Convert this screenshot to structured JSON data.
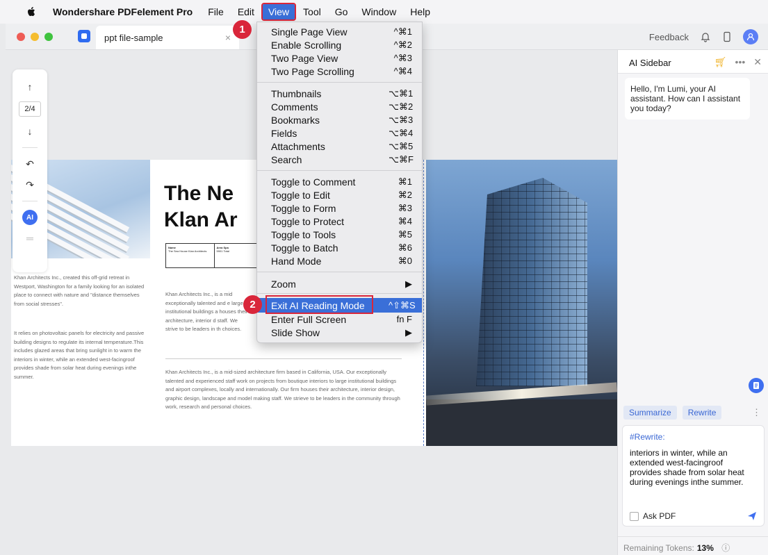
{
  "menubar": {
    "app": "Wondershare PDFelement Pro",
    "items": [
      "File",
      "Edit",
      "View",
      "Tool",
      "Go",
      "Window",
      "Help"
    ]
  },
  "tab": {
    "title": "ppt file-sample",
    "close": "×"
  },
  "toolbar_right": {
    "feedback": "Feedback"
  },
  "left_tools": {
    "page": "2/4",
    "ai": "AI"
  },
  "document": {
    "headline_1": "The Ne",
    "headline_2": "Klan Ar",
    "table_col1": "Name",
    "table_col2": "Area Spa",
    "table_val1": "The Sea House Klan Architects",
    "table_val2": "5901 Total",
    "left_para1": "Khan Architects Inc., created this off-grid retreat in Westport, Washington for a family looking for an isolated place to connect with nature and \"distance themselves from social stresses\".",
    "left_para2": "It relies on photovoltaic panels for electricity and passive building designs to regulate its internal temperature.This includes glazed areas that bring sunlight in to warm the interiors in winter, while an extended west-facingroof provides shade from solar heat during evenings inthe summer.",
    "mid_para1": "Khan Architects Inc., is a mid exceptionally talented and e large institutional buildings a houses their architecture, interior d staff. We strive to be leaders in th choices.",
    "mid_para2": "Khan Architects Inc., is a mid-sized architecture firm based in California, USA. Our exceptionally talented and experienced staff work on projects from boutique interiors to large institutional buildings and airport complexes, locally and internationally. Our firm houses their architecture, interior design, graphic design, landscape and model making staff. We strieve to be leaders in the community through work, research and personal choices."
  },
  "view_menu": {
    "items": [
      {
        "label": "Single Page View",
        "shortcut": "^⌘1"
      },
      {
        "label": "Enable Scrolling",
        "shortcut": "^⌘2"
      },
      {
        "label": "Two Page View",
        "shortcut": "^⌘3"
      },
      {
        "label": "Two Page Scrolling",
        "shortcut": "^⌘4"
      },
      {
        "label": "Thumbnails",
        "shortcut": "⌥⌘1"
      },
      {
        "label": "Comments",
        "shortcut": "⌥⌘2"
      },
      {
        "label": "Bookmarks",
        "shortcut": "⌥⌘3"
      },
      {
        "label": "Fields",
        "shortcut": "⌥⌘4"
      },
      {
        "label": "Attachments",
        "shortcut": "⌥⌘5"
      },
      {
        "label": "Search",
        "shortcut": "⌥⌘F"
      },
      {
        "label": "Toggle to Comment",
        "shortcut": "⌘1"
      },
      {
        "label": "Toggle to Edit",
        "shortcut": "⌘2"
      },
      {
        "label": "Toggle to Form",
        "shortcut": "⌘3"
      },
      {
        "label": "Toggle to Protect",
        "shortcut": "⌘4"
      },
      {
        "label": "Toggle to Tools",
        "shortcut": "⌘5"
      },
      {
        "label": "Toggle to Batch",
        "shortcut": "⌘6"
      },
      {
        "label": "Hand Mode",
        "shortcut": "⌘0"
      },
      {
        "label": "Zoom",
        "shortcut": "▶"
      },
      {
        "label": "Exit AI Reading Mode",
        "shortcut": "^⇧⌘S"
      },
      {
        "label": "Enter Full Screen",
        "shortcut": "fn F"
      },
      {
        "label": "Slide Show",
        "shortcut": "▶"
      }
    ]
  },
  "steps": [
    "1",
    "2"
  ],
  "sidebar": {
    "title": "AI Sidebar",
    "greeting": "Hello, I'm Lumi, your AI assistant. How can I assistant you today?",
    "chips": [
      "Summarize",
      "Rewrite"
    ],
    "tag": "#Rewrite:",
    "input_text": "interiors in winter, while an extended west-facingroof provides shade from solar heat during evenings inthe summer.",
    "ask_pdf": "Ask PDF",
    "tokens_label": "Remaining Tokens:",
    "tokens_value": "13%"
  },
  "colors": {
    "accent": "#3a6fd8",
    "highlight": "#d9263a"
  }
}
